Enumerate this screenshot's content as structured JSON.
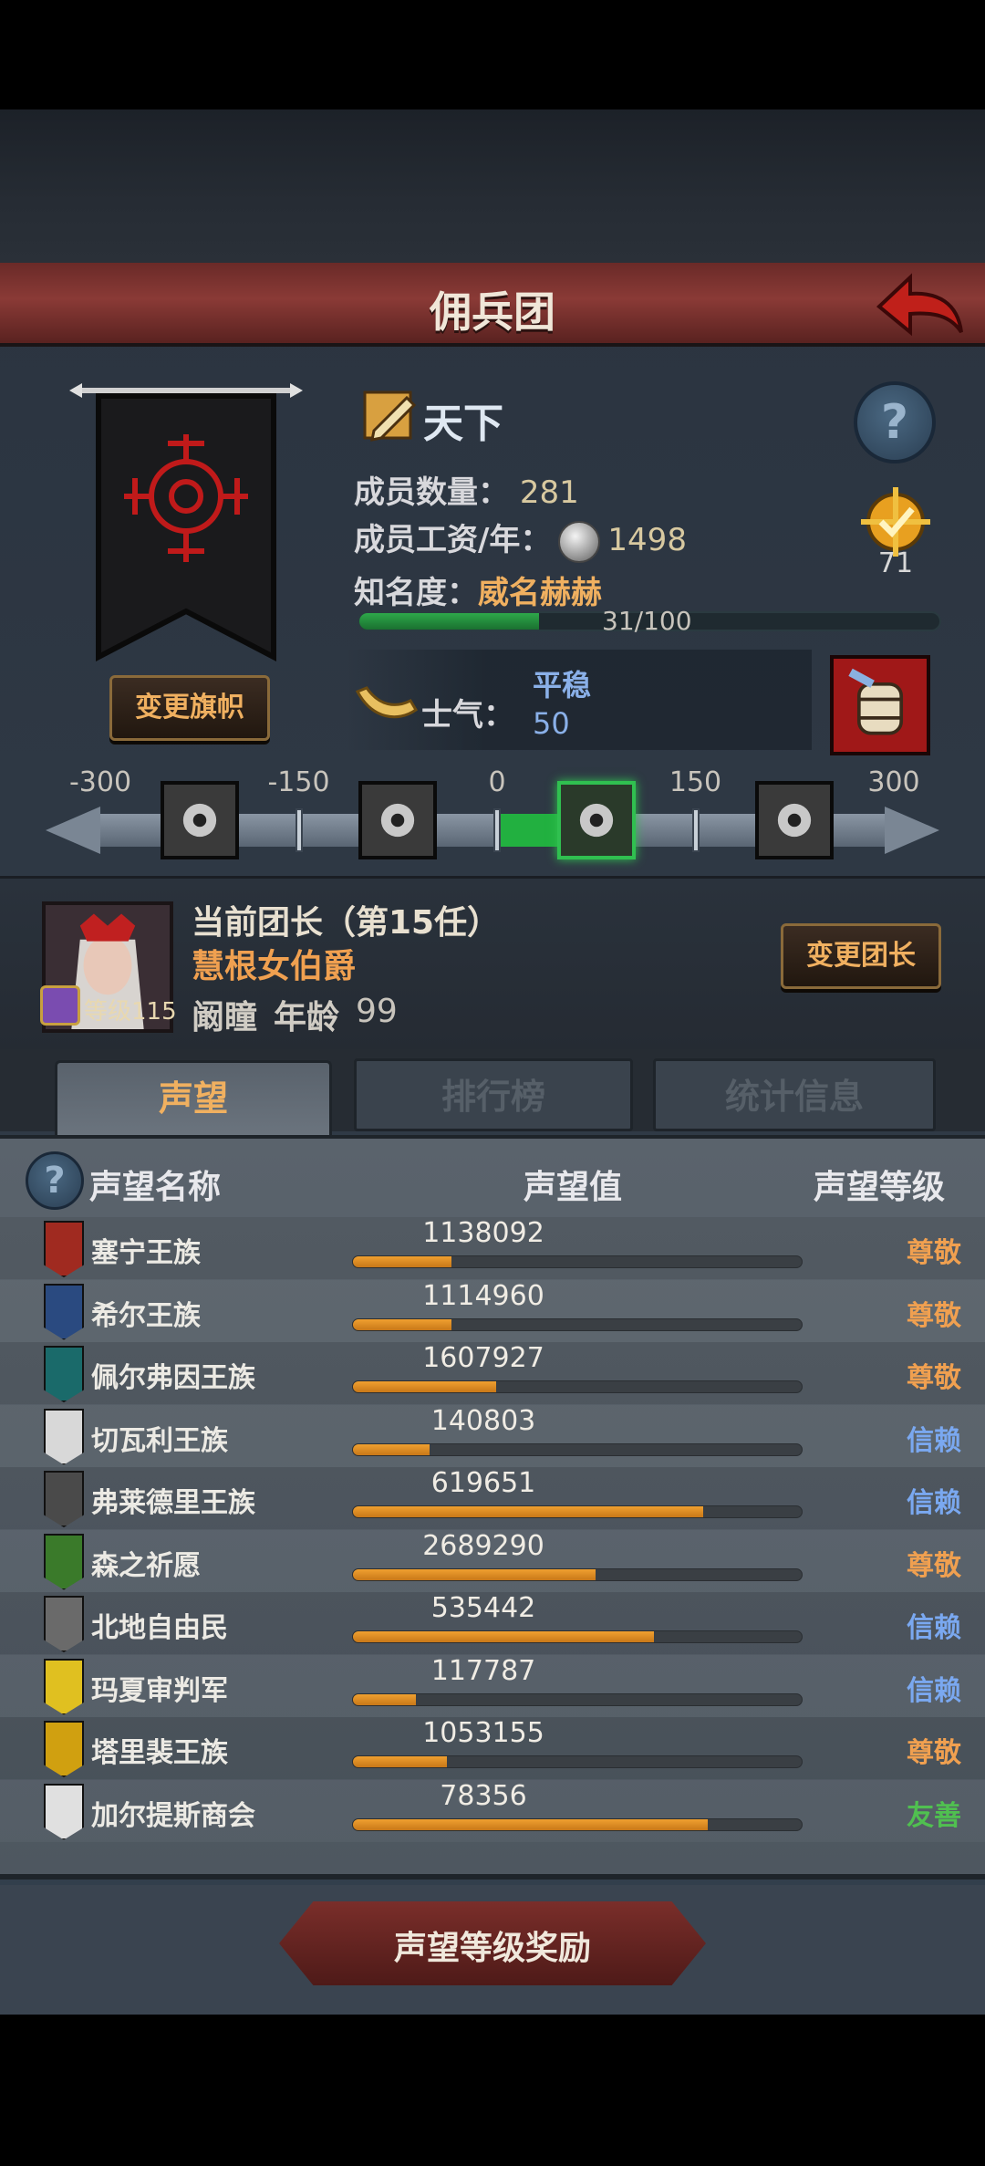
{
  "header": {
    "title": "佣兵团"
  },
  "guild": {
    "name": "天下",
    "change_flag_label": "变更旗帜",
    "members_label": "成员数量：",
    "members": "281",
    "wage_label": "成员工资/年：",
    "wage": "1498",
    "fame_label": "知名度：",
    "fame_value": "威名赫赫",
    "fame_progress": "31/100",
    "fame_fraction": 0.31,
    "medal_count": "71",
    "morale_label": "士气：",
    "morale_state": "平稳",
    "morale_value": "50"
  },
  "morale_scale": {
    "ticks": [
      "-300",
      "-150",
      "0",
      "150",
      "300"
    ],
    "value": 50,
    "icons": [
      "eye-icon",
      "despair-icon",
      "calm-icon",
      "charge-icon"
    ],
    "active_icon": 2
  },
  "leader": {
    "title": "当前团长（第15任）",
    "name": "慧根女伯爵",
    "level_label": "等级",
    "level": "115",
    "trait": "阚瞳",
    "age_label": "年龄",
    "age": "99",
    "change_leader_label": "变更团长"
  },
  "tabs": [
    {
      "label": "声望",
      "active": true
    },
    {
      "label": "排行榜",
      "active": false
    },
    {
      "label": "统计信息",
      "active": false
    }
  ],
  "table": {
    "col_name": "声望名称",
    "col_value": "声望值",
    "col_level": "声望等级",
    "rows": [
      {
        "name": "塞宁王族",
        "value": "1138092",
        "fraction": 0.22,
        "level": "尊敬",
        "level_color": "#f0a050",
        "emblem_color": "#a02a20"
      },
      {
        "name": "希尔王族",
        "value": "1114960",
        "fraction": 0.22,
        "level": "尊敬",
        "level_color": "#f0a050",
        "emblem_color": "#2a4a80"
      },
      {
        "name": "佩尔弗因王族",
        "value": "1607927",
        "fraction": 0.32,
        "level": "尊敬",
        "level_color": "#f0a050",
        "emblem_color": "#1a6a6a"
      },
      {
        "name": "切瓦利王族",
        "value": "140803",
        "fraction": 0.17,
        "level": "信赖",
        "level_color": "#7aa8f0",
        "emblem_color": "#d8d8d8"
      },
      {
        "name": "弗莱德里王族",
        "value": "619651",
        "fraction": 0.78,
        "level": "信赖",
        "level_color": "#7aa8f0",
        "emblem_color": "#4a4a4a"
      },
      {
        "name": "森之祈愿",
        "value": "2689290",
        "fraction": 0.54,
        "level": "尊敬",
        "level_color": "#f0a050",
        "emblem_color": "#3a7a2a"
      },
      {
        "name": "北地自由民",
        "value": "535442",
        "fraction": 0.67,
        "level": "信赖",
        "level_color": "#7aa8f0",
        "emblem_color": "#6a6a6a"
      },
      {
        "name": "玛夏审判军",
        "value": "117787",
        "fraction": 0.14,
        "level": "信赖",
        "level_color": "#7aa8f0",
        "emblem_color": "#e0c020"
      },
      {
        "name": "塔里裴王族",
        "value": "1053155",
        "fraction": 0.21,
        "level": "尊敬",
        "level_color": "#f0a050",
        "emblem_color": "#d0a010"
      },
      {
        "name": "加尔提斯商会",
        "value": "78356",
        "fraction": 0.79,
        "level": "友善",
        "level_color": "#50c050",
        "emblem_color": "#e0e0e0"
      }
    ]
  },
  "reward_button": "声望等级奖励"
}
